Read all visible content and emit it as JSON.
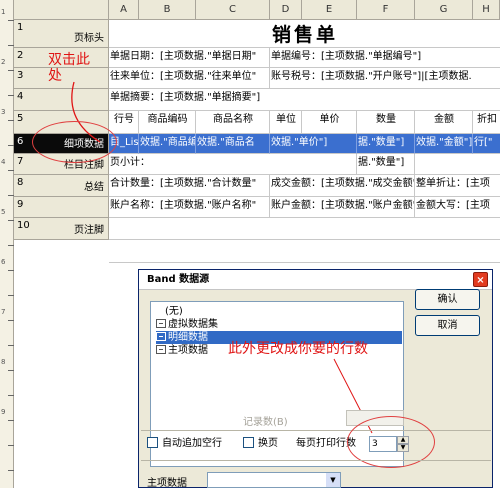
{
  "columns": [
    "A",
    "B",
    "C",
    "D",
    "E",
    "F",
    "G",
    "H"
  ],
  "rows": [
    {
      "num": "1",
      "label": "页标头"
    },
    {
      "num": "2",
      "label": ""
    },
    {
      "num": "3",
      "label": ""
    },
    {
      "num": "4",
      "label": ""
    },
    {
      "num": "5",
      "label": ""
    },
    {
      "num": "6",
      "label": "细项数据"
    },
    {
      "num": "7",
      "label": "栏目注脚"
    },
    {
      "num": "8",
      "label": "总结"
    },
    {
      "num": "9",
      "label": ""
    },
    {
      "num": "10",
      "label": "页注脚"
    }
  ],
  "ruler_numbers": [
    "1",
    "2",
    "3",
    "4",
    "5",
    "6",
    "7",
    "8",
    "9"
  ],
  "cells": {
    "title": "销售单",
    "r2_a": "单据日期：[主项数据.\"单据日期\"",
    "r2_d": "单据编号：[主项数据.\"单据编号\"]",
    "r3_a": "往来单位：[主项数据.\"往来单位\"",
    "r3_d": "账号税号：[主项数据.\"开户账号\"]|[主项数据.",
    "r4_a": "单据摘要：[主项数据.\"单据摘要\"]",
    "r5_headers": [
      "行号",
      "商品编码",
      "商品名称",
      "单位",
      "单价",
      "数量",
      "金额",
      "折扣"
    ],
    "r6_a": "目_List",
    "r6_b": "效据.\"商品编",
    "r6_c": "效据.\"商品名",
    "r6_de": "效据.\"单价\"]",
    "r6_f": "据.\"数量\"]",
    "r6_g": "效据.\"金额\"]",
    "r6_h": "行[\"",
    "r7_a": "页小计：",
    "r7_f": "据.\"数量\"]",
    "r8_a": "合计数量：[主项数据.\"合计数量\"",
    "r8_d": "成交金额：[主项数据.\"成交金额\"",
    "r8_g": "整单折让：[主项",
    "r9_a": "账户名称：[主项数据.\"账户名称\"",
    "r9_d": "账户金额：[主项数据.\"账户金额\"",
    "r9_g": "金额大写：[主项"
  },
  "annotations": {
    "double_click_line1": "双击此",
    "double_click_line2": "处",
    "change_hint": "此外更改成你要的行数"
  },
  "dialog": {
    "title": "Band 数据源",
    "close_label": "×",
    "list_items": [
      "(无)",
      "虚拟数据集",
      "明细数据",
      "主项数据"
    ],
    "selected_index": 2,
    "ok_label": "确认",
    "cancel_label": "取消",
    "record_count_label": "记录数(B)",
    "auto_add_label": "自动追加空行",
    "page_break_label": "换页",
    "rows_per_page_label": "每页打印行数",
    "rows_per_page_value": "3",
    "main_data_label": "主项数据"
  },
  "colors": {
    "selection": "#316ac5",
    "annotation": "#e01515",
    "row_header_bg": "#ece9d8"
  }
}
